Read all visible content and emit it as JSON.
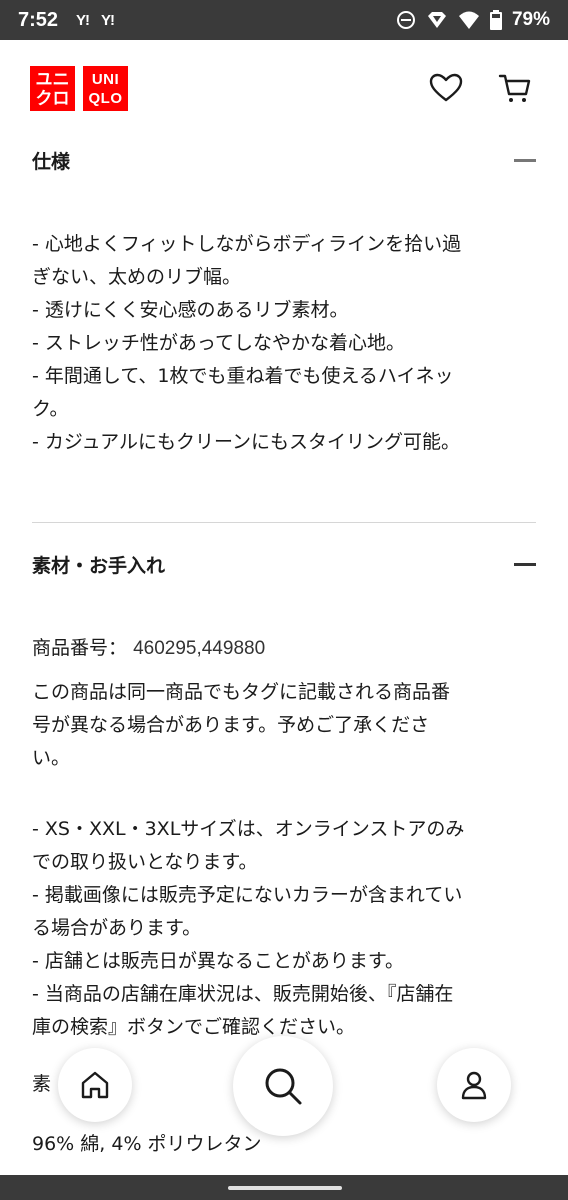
{
  "status_bar": {
    "time": "7:52",
    "notif_1": "Y!",
    "notif_2": "Y!",
    "battery": "79%"
  },
  "header": {
    "logo_jp_top": "ユニ",
    "logo_jp_bottom": "クロ",
    "logo_en_top": "UNI",
    "logo_en_bottom": "QLO",
    "brand_color": "#ff0000"
  },
  "spec_section": {
    "title": "仕様",
    "lines": [
      "- 心地よくフィットしながらボディラインを拾い過",
      "ぎない、太めのリブ幅。",
      "- 透けにくく安心感のあるリブ素材。",
      "- ストレッチ性があってしなやかな着心地。",
      "- 年間通して、1枚でも重ね着でも使えるハイネッ",
      "ク。",
      "- カジュアルにもクリーンにもスタイリング可能。"
    ]
  },
  "material_section": {
    "title": "素材・お手入れ",
    "product_number_label": "商品番号：",
    "product_number": "460295,449880",
    "note_lines": [
      "この商品は同一商品でもタグに記載される商品番",
      "号が異なる場合があります。予めご了承くださ",
      "い。"
    ],
    "bullet_lines": [
      "- XS・XXL・3XLサイズは、オンラインストアのみ",
      "での取り扱いとなります。",
      "- 掲載画像には販売予定にないカラーが含まれてい",
      "る場合があります。",
      "- 店舗とは販売日が異なることがあります。",
      "- 当商品の店舗在庫状況は、販売開始後、『店舗在",
      "庫の検索』ボタンでご確認ください。"
    ],
    "sub_heading_partial": "素",
    "composition": "96% 綿, 4% ポリウレタン"
  },
  "icons": {
    "wishlist": "heart-icon",
    "cart": "cart-icon",
    "home": "home-icon",
    "search": "search-icon",
    "account": "user-icon"
  }
}
